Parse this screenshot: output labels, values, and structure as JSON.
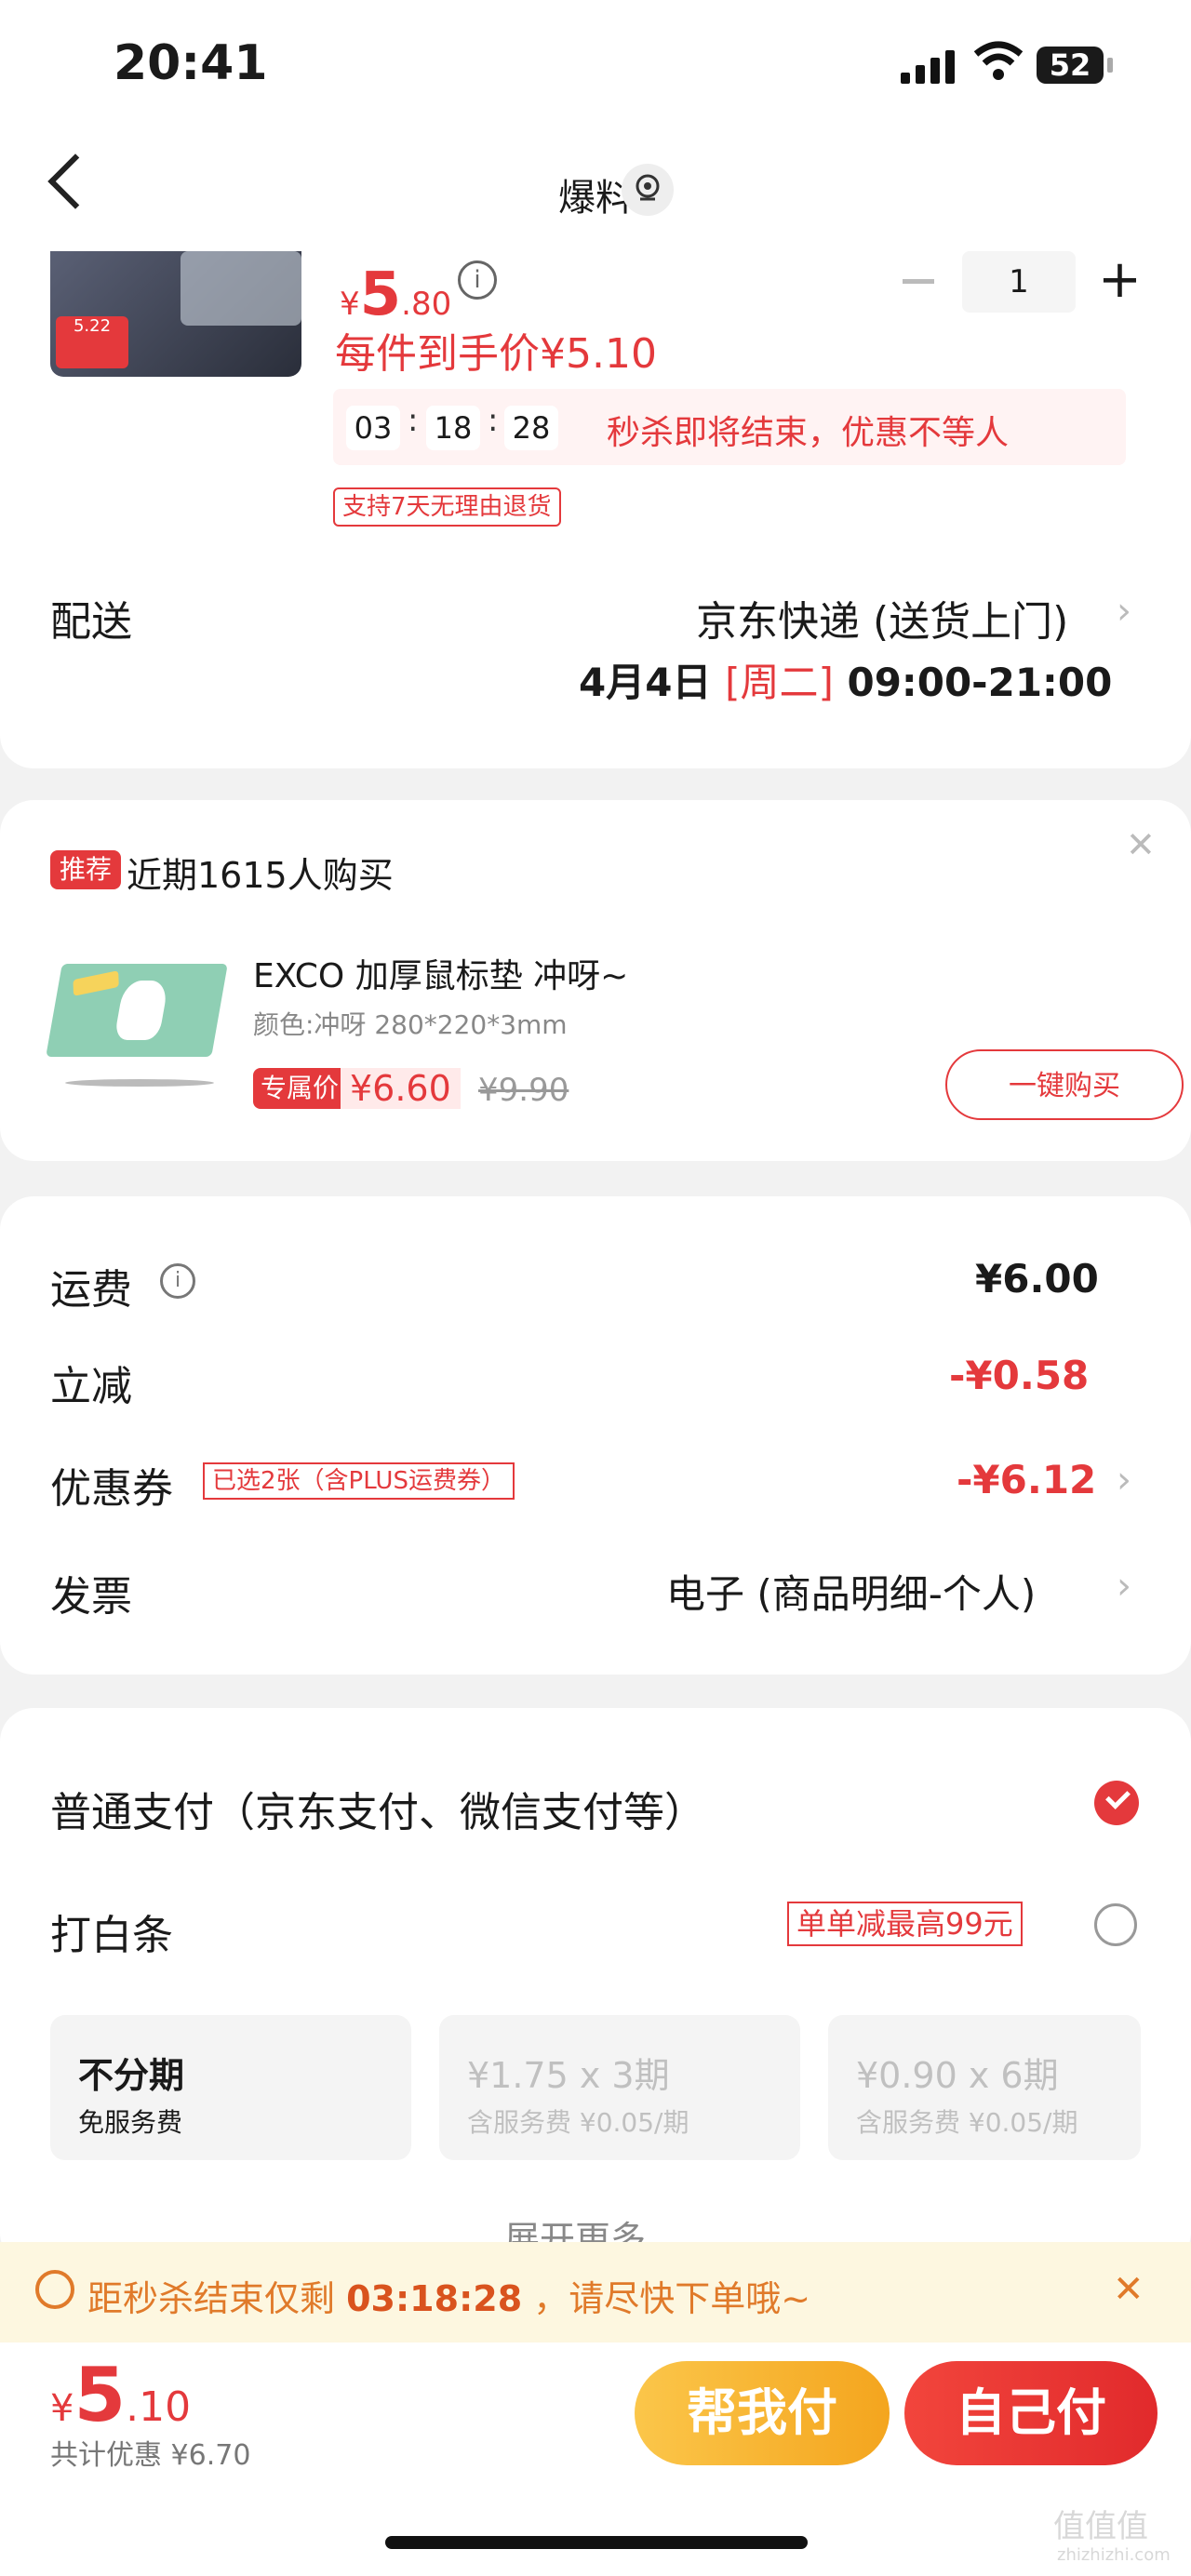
{
  "status_bar": {
    "time": "20:41",
    "battery": "52"
  },
  "nav": {
    "title": "爆料"
  },
  "product": {
    "image_tag": "5.22",
    "currency": "¥",
    "price_int": "5",
    "price_dec": ".80",
    "quantity": "1",
    "each_price": "每件到手价¥5.10",
    "timer": {
      "h": "03",
      "m": "18",
      "s": "28",
      "text": "秒杀即将结束，优惠不等人"
    },
    "return_tag": "支持7天无理由退货"
  },
  "delivery": {
    "label": "配送",
    "carrier": "京东快递 (送货上门)",
    "date": "4月4日",
    "weekday": "[周二]",
    "window": "09:00-21:00"
  },
  "recommend": {
    "badge": "推荐",
    "text": "近期1615人购买",
    "item_title": "EXCO 加厚鼠标垫 冲呀~",
    "item_spec": "颜色:冲呀 280*220*3mm",
    "exclusive_badge": "专属价",
    "price": "¥6.60",
    "original_price": "¥9.90",
    "buy_button": "一键购买"
  },
  "fees": {
    "shipping_label": "运费",
    "shipping_value": "¥6.00",
    "discount_label": "立减",
    "discount_value": "-¥0.58",
    "coupon_label": "优惠券",
    "coupon_tag": "已选2张（含PLUS运费券）",
    "coupon_value": "-¥6.12",
    "invoice_label": "发票",
    "invoice_value": "电子 (商品明细-个人)"
  },
  "payment": {
    "normal": "普通支付（京东支付、微信支付等）",
    "baitiao": "打白条",
    "baitiao_tag": "单单减最高99元",
    "plans": [
      {
        "title": "不分期",
        "sub": "免服务费"
      },
      {
        "title": "¥1.75 x 3期",
        "sub": "含服务费 ¥0.05/期"
      },
      {
        "title": "¥0.90 x 6期",
        "sub": "含服务费 ¥0.05/期"
      }
    ],
    "expand": "展开更多"
  },
  "banner": {
    "prefix": "距秒杀结束仅剩",
    "time": "03:18:28",
    "suffix": "，请尽快下单哦~"
  },
  "bottom": {
    "currency": "¥",
    "total_int": "5",
    "total_dec": ".10",
    "saving": "共计优惠 ¥6.70",
    "help_pay": "帮我付",
    "self_pay": "自己付"
  },
  "watermark": {
    "main": "值值值",
    "sub": "zhizhizhi.com"
  },
  "colors": {
    "accent": "#e4393c",
    "orange": "#e07a2a",
    "banner_bg": "#fdf7e0"
  }
}
